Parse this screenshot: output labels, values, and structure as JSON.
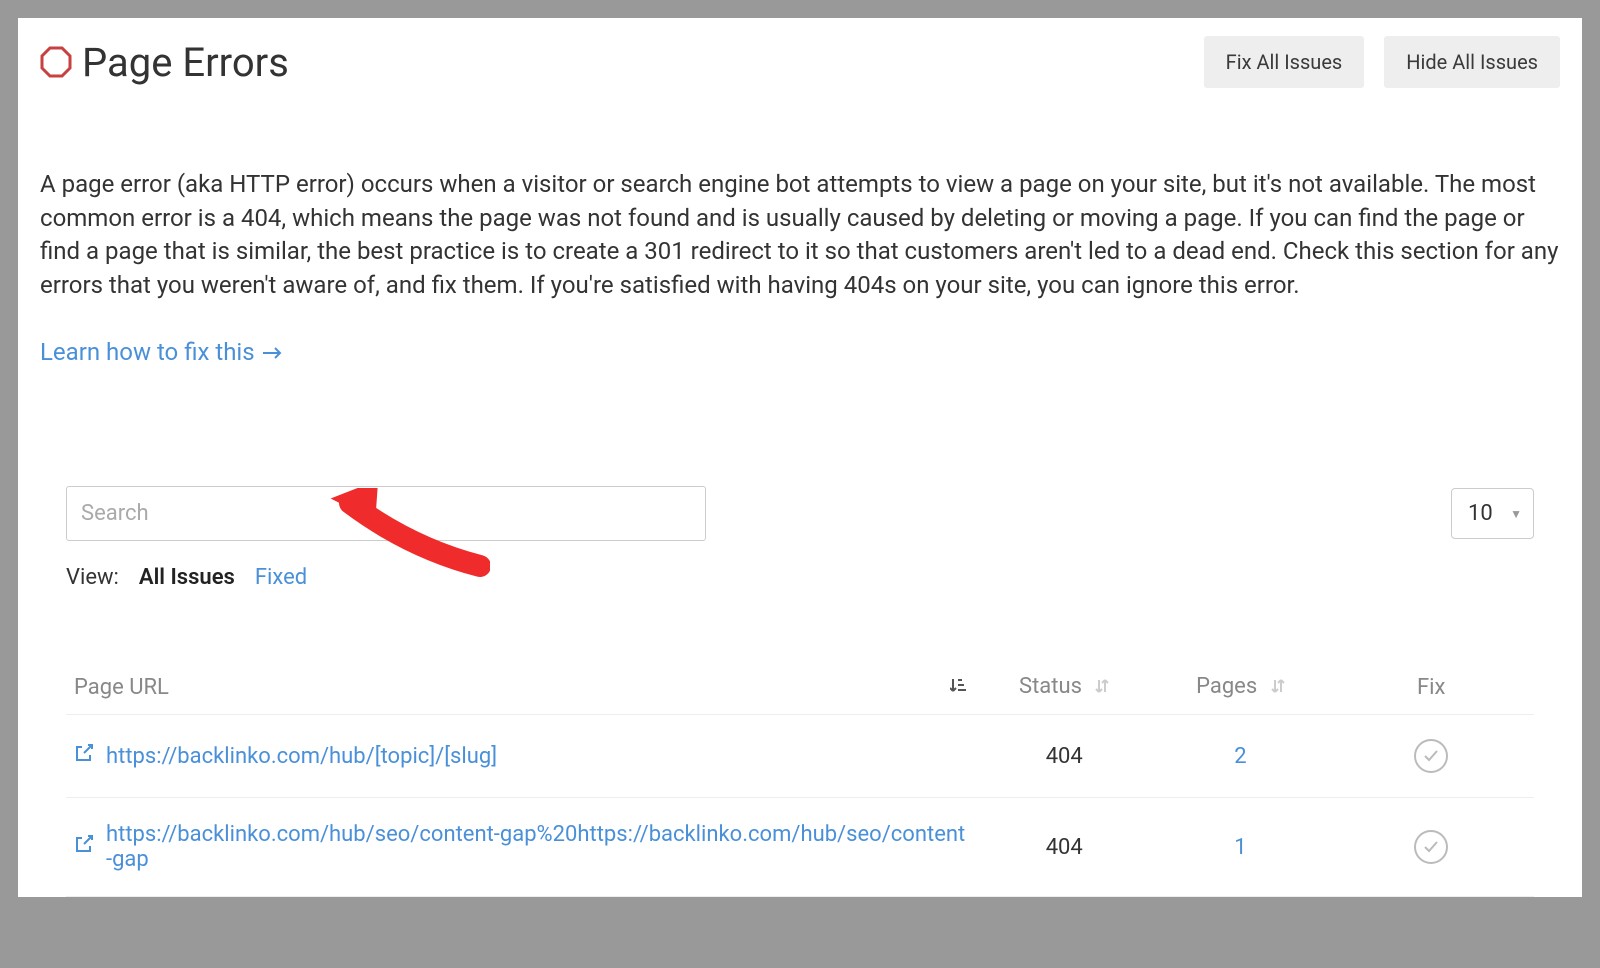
{
  "header": {
    "title": "Page Errors",
    "fix_all_label": "Fix All Issues",
    "hide_all_label": "Hide All Issues"
  },
  "description": "A page error (aka HTTP error) occurs when a visitor or search engine bot attempts to view a page on your site, but it's not available. The most common error is a 404, which means the page was not found and is usually caused by deleting or moving a page. If you can find the page or find a page that is similar, the best practice is to create a 301 redirect to it so that customers aren't led to a dead end. Check this section for any errors that you weren't aware of, and fix them. If you're satisfied with having 404s on your site, you can ignore this error.",
  "learn_link": "Learn how to fix this",
  "search": {
    "placeholder": "Search"
  },
  "page_size": {
    "selected": "10"
  },
  "view": {
    "label": "View:",
    "tabs": [
      {
        "label": "All Issues",
        "active": true
      },
      {
        "label": "Fixed",
        "active": false
      }
    ]
  },
  "table": {
    "columns": {
      "url": "Page URL",
      "status": "Status",
      "pages": "Pages",
      "fix": "Fix"
    },
    "rows": [
      {
        "url": "https://backlinko.com/hub/[topic]/[slug]",
        "status": "404",
        "pages": "2"
      },
      {
        "url": "https://backlinko.com/hub/seo/content-gap%20https://backlinko.com/hub/seo/content-gap",
        "status": "404",
        "pages": "1"
      }
    ]
  },
  "colors": {
    "link": "#4a90d9",
    "error_icon": "#c94040"
  }
}
